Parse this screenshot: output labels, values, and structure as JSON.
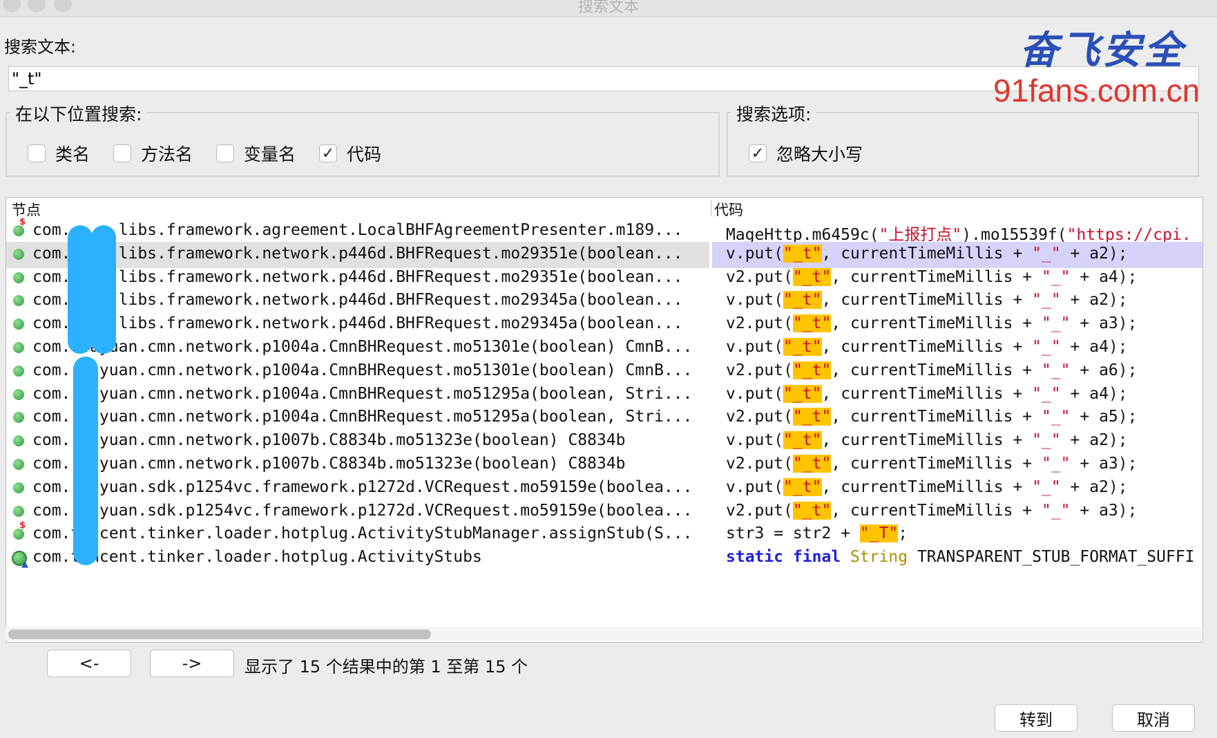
{
  "window": {
    "title": "搜索文本"
  },
  "search": {
    "label": "搜索文本:",
    "value": "\"_t\""
  },
  "scope": {
    "legend": "在以下位置搜索:",
    "options": [
      {
        "label": "类名",
        "checked": false
      },
      {
        "label": "方法名",
        "checked": false
      },
      {
        "label": "变量名",
        "checked": false
      },
      {
        "label": "代码",
        "checked": true
      }
    ]
  },
  "search_options": {
    "legend": "搜索选项:",
    "options": [
      {
        "label": "忽略大小写",
        "checked": true
      }
    ]
  },
  "results": {
    "columns": {
      "node": "节点",
      "code": "代码"
    },
    "rows": [
      {
        "node": "com.  .e.libs.framework.agreement.LocalBHFAgreementPresenter.m189...",
        "icon": "method-dollar-icon",
        "code": [
          [
            "t",
            "MageHttp.m6459c"
          ],
          [
            "p",
            "("
          ],
          [
            "s",
            "\"上报打点\""
          ],
          [
            "p",
            ")"
          ],
          [
            "t",
            ".mo15539f"
          ],
          [
            "p",
            "("
          ],
          [
            "s",
            "\"https://cpi."
          ]
        ]
      },
      {
        "node": "com.  .e.libs.framework.network.p446d.BHFRequest.mo29351e(boolean...",
        "icon": "method-icon",
        "selected": true,
        "code": [
          [
            "t",
            "v.put"
          ],
          [
            "p",
            "("
          ],
          [
            "h",
            "\"_t\""
          ],
          [
            "t",
            ", currentTimeMillis + "
          ],
          [
            "s",
            "\"_\""
          ],
          [
            "t",
            " + a2"
          ],
          [
            "p",
            ");"
          ]
        ]
      },
      {
        "node": "com.  .e.libs.framework.network.p446d.BHFRequest.mo29351e(boolean...",
        "icon": "method-icon",
        "code": [
          [
            "t",
            "v2.put"
          ],
          [
            "p",
            "("
          ],
          [
            "h",
            "\"_t\""
          ],
          [
            "t",
            ", currentTimeMillis + "
          ],
          [
            "s",
            "\"_\""
          ],
          [
            "t",
            " + a4"
          ],
          [
            "p",
            ");"
          ]
        ]
      },
      {
        "node": "com.  .e.libs.framework.network.p446d.BHFRequest.mo29345a(boolean...",
        "icon": "method-icon",
        "code": [
          [
            "t",
            "v.put"
          ],
          [
            "p",
            "("
          ],
          [
            "h",
            "\"_t\""
          ],
          [
            "t",
            ", currentTimeMillis + "
          ],
          [
            "s",
            "\"_\""
          ],
          [
            "t",
            " + a2"
          ],
          [
            "p",
            ");"
          ]
        ]
      },
      {
        "node": "com.  .e.libs.framework.network.p446d.BHFRequest.mo29345a(boolean...",
        "icon": "method-icon",
        "code": [
          [
            "t",
            "v2.put"
          ],
          [
            "p",
            "("
          ],
          [
            "h",
            "\"_t\""
          ],
          [
            "t",
            ", currentTimeMillis + "
          ],
          [
            "s",
            "\"_\""
          ],
          [
            "t",
            " + a3"
          ],
          [
            "p",
            ");"
          ]
        ]
      },
      {
        "node": "com.  ayuan.cmn.network.p1004a.CmnBHRequest.mo51301e(boolean) CmnB...",
        "icon": "method-icon",
        "code": [
          [
            "t",
            "v.put"
          ],
          [
            "p",
            "("
          ],
          [
            "h",
            "\"_t\""
          ],
          [
            "t",
            ", currentTimeMillis + "
          ],
          [
            "s",
            "\"_\""
          ],
          [
            "t",
            " + a4"
          ],
          [
            "p",
            ");"
          ]
        ]
      },
      {
        "node": "com.  ayuan.cmn.network.p1004a.CmnBHRequest.mo51301e(boolean) CmnB...",
        "icon": "method-icon",
        "code": [
          [
            "t",
            "v2.put"
          ],
          [
            "p",
            "("
          ],
          [
            "h",
            "\"_t\""
          ],
          [
            "t",
            ", currentTimeMillis + "
          ],
          [
            "s",
            "\"_\""
          ],
          [
            "t",
            " + a6"
          ],
          [
            "p",
            ");"
          ]
        ]
      },
      {
        "node": "com.  ayuan.cmn.network.p1004a.CmnBHRequest.mo51295a(boolean, Stri...",
        "icon": "method-icon",
        "code": [
          [
            "t",
            "v.put"
          ],
          [
            "p",
            "("
          ],
          [
            "h",
            "\"_t\""
          ],
          [
            "t",
            ", currentTimeMillis + "
          ],
          [
            "s",
            "\"_\""
          ],
          [
            "t",
            " + a4"
          ],
          [
            "p",
            ");"
          ]
        ]
      },
      {
        "node": "com.  ayuan.cmn.network.p1004a.CmnBHRequest.mo51295a(boolean, Stri...",
        "icon": "method-icon",
        "code": [
          [
            "t",
            "v2.put"
          ],
          [
            "p",
            "("
          ],
          [
            "h",
            "\"_t\""
          ],
          [
            "t",
            ", currentTimeMillis + "
          ],
          [
            "s",
            "\"_\""
          ],
          [
            "t",
            " + a5"
          ],
          [
            "p",
            ");"
          ]
        ]
      },
      {
        "node": "com.  ayuan.cmn.network.p1007b.C8834b.mo51323e(boolean) C8834b",
        "icon": "method-icon",
        "code": [
          [
            "t",
            "v.put"
          ],
          [
            "p",
            "("
          ],
          [
            "h",
            "\"_t\""
          ],
          [
            "t",
            ", currentTimeMillis + "
          ],
          [
            "s",
            "\"_\""
          ],
          [
            "t",
            " + a2"
          ],
          [
            "p",
            ");"
          ]
        ]
      },
      {
        "node": "com.  ayuan.cmn.network.p1007b.C8834b.mo51323e(boolean) C8834b",
        "icon": "method-icon",
        "code": [
          [
            "t",
            "v2.put"
          ],
          [
            "p",
            "("
          ],
          [
            "h",
            "\"_t\""
          ],
          [
            "t",
            ", currentTimeMillis + "
          ],
          [
            "s",
            "\"_\""
          ],
          [
            "t",
            " + a3"
          ],
          [
            "p",
            ");"
          ]
        ]
      },
      {
        "node": "com.  ayuan.sdk.p1254vc.framework.p1272d.VCRequest.mo59159e(boolea...",
        "icon": "method-icon",
        "code": [
          [
            "t",
            "v.put"
          ],
          [
            "p",
            "("
          ],
          [
            "h",
            "\"_t\""
          ],
          [
            "t",
            ", currentTimeMillis + "
          ],
          [
            "s",
            "\"_\""
          ],
          [
            "t",
            " + a2"
          ],
          [
            "p",
            ");"
          ]
        ]
      },
      {
        "node": "com.  ayuan.sdk.p1254vc.framework.p1272d.VCRequest.mo59159e(boolea...",
        "icon": "method-icon",
        "code": [
          [
            "t",
            "v2.put"
          ],
          [
            "p",
            "("
          ],
          [
            "h",
            "\"_t\""
          ],
          [
            "t",
            ", currentTimeMillis + "
          ],
          [
            "s",
            "\"_\""
          ],
          [
            "t",
            " + a3"
          ],
          [
            "p",
            ");"
          ]
        ]
      },
      {
        "node": "com.tencent.tinker.loader.hotplug.ActivityStubManager.assignStub(S...",
        "icon": "method-dollar-icon",
        "code": [
          [
            "t",
            "str3 = str2 + "
          ],
          [
            "h",
            "\"_T\""
          ],
          [
            "p",
            ";"
          ]
        ]
      },
      {
        "node": "com.tencent.tinker.loader.hotplug.ActivityStubs",
        "icon": "class-icon",
        "code": [
          [
            "k",
            "static final "
          ],
          [
            "y",
            "String "
          ],
          [
            "t",
            "TRANSPARENT_STUB_FORMAT_SUFFI"
          ]
        ]
      }
    ]
  },
  "pager": {
    "prev": "<-",
    "next": "->",
    "status": "显示了 15 个结果中的第 1 至第 15 个"
  },
  "actions": {
    "goto": "转到",
    "cancel": "取消"
  },
  "watermark": {
    "cn": "奋飞安全",
    "url": "91fans.com.cn"
  },
  "colors": {
    "selection": "#d6d3fb",
    "match_highlight": "#ffc400",
    "string": "#c8102e",
    "keyword": "#1f1fe0",
    "redaction": "#2bb1ff"
  }
}
